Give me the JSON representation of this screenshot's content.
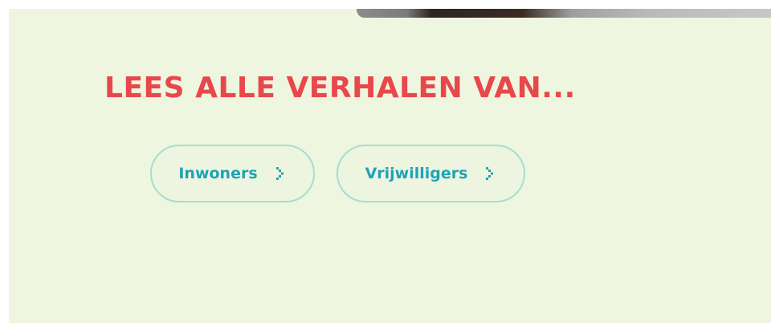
{
  "section": {
    "heading": "LEES ALLE VERHALEN VAN...",
    "buttons": [
      {
        "label": "Inwoners",
        "icon": "chevron-right-icon"
      },
      {
        "label": "Vrijwilligers",
        "icon": "chevron-right-icon"
      }
    ]
  },
  "colors": {
    "background": "#eef6df",
    "heading": "#e8474b",
    "button_text": "#1ea3b6",
    "button_border": "#a6ddd2"
  }
}
